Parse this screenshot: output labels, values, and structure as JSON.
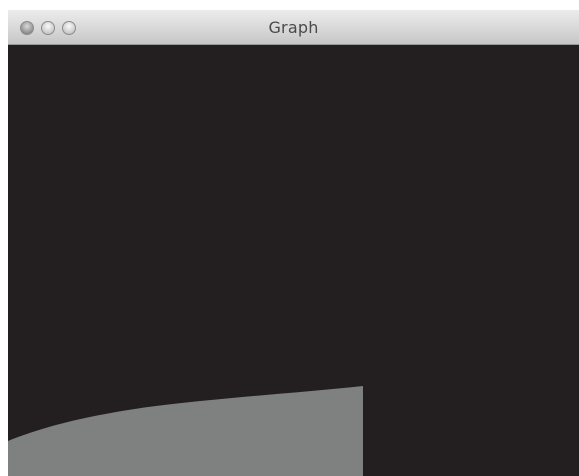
{
  "window": {
    "title": "Graph",
    "buttons": [
      "close",
      "minimize",
      "zoom"
    ]
  },
  "canvas": {
    "background_color": "#231f20",
    "shape_color": "#7f8080"
  }
}
